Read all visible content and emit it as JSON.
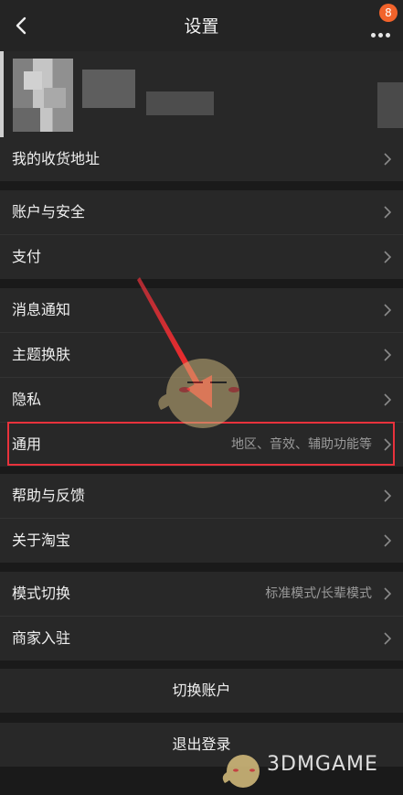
{
  "header": {
    "title": "设置",
    "badge_count": "8"
  },
  "menu": {
    "address": "我的收货地址",
    "account_security": "账户与安全",
    "payment": "支付",
    "notifications": "消息通知",
    "theme": "主题换肤",
    "privacy": "隐私",
    "general": "通用",
    "general_desc": "地区、音效、辅助功能等",
    "help": "帮助与反馈",
    "about": "关于淘宝",
    "mode_switch": "模式切换",
    "mode_switch_desc": "标准模式/长辈模式",
    "merchant": "商家入驻"
  },
  "actions": {
    "switch_account": "切换账户",
    "logout": "退出登录"
  },
  "watermark": {
    "text": "3DMGAME"
  },
  "colors": {
    "background": "#1a1a1a",
    "row": "#282828",
    "highlight": "#e8323c",
    "badge": "#f2632b"
  }
}
